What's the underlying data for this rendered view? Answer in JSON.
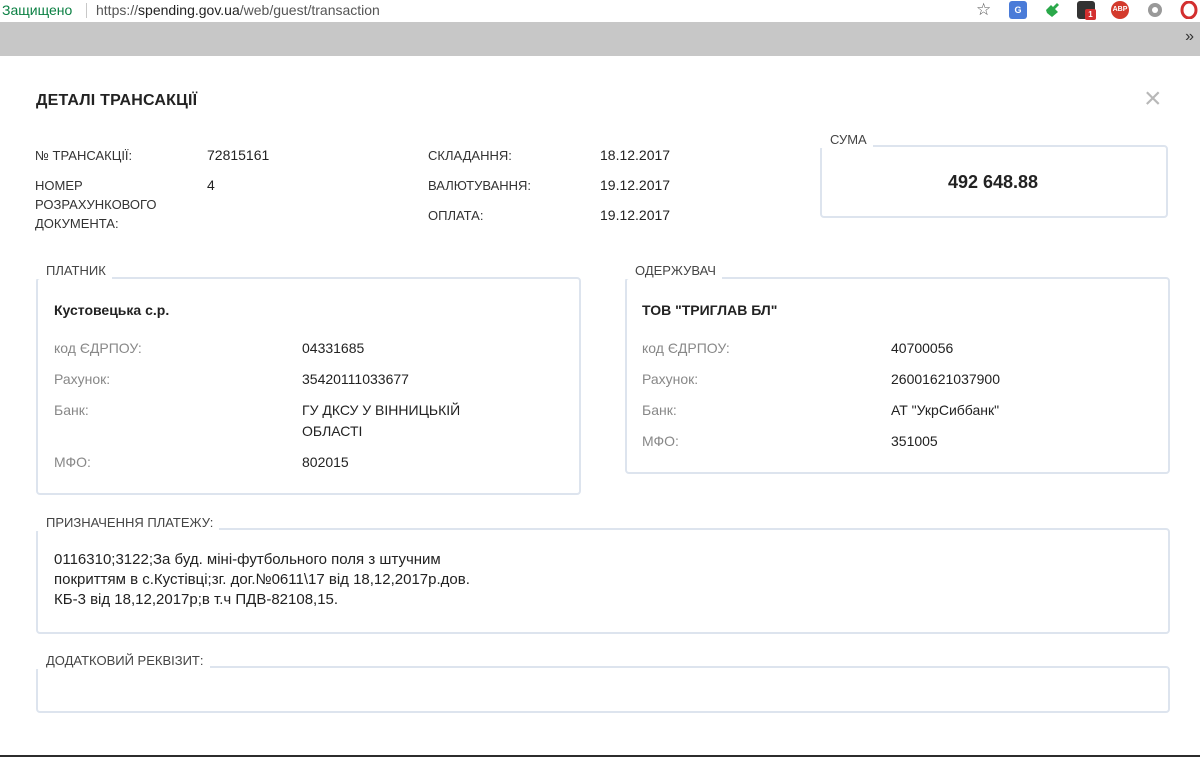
{
  "browser": {
    "secure_label": "Защищено",
    "url_scheme": "https://",
    "url_host": "spending.gov.ua",
    "url_path": "/web/guest/transaction",
    "chevron": "»",
    "extensions": [
      {
        "name": "translate-icon",
        "color": "#4a7bd8",
        "text": "G"
      },
      {
        "name": "puzzle-icon",
        "color": "#2aa84a",
        "text": ""
      },
      {
        "name": "ghost-extension-icon",
        "color": "#333333",
        "text": "1"
      },
      {
        "name": "adblock-icon",
        "color": "#d33a2c",
        "text": "ABP"
      },
      {
        "name": "circle-extension-icon",
        "color": "#888888",
        "text": ""
      },
      {
        "name": "opera-icon",
        "color": "#d32f2f",
        "text": "O"
      }
    ]
  },
  "dialog": {
    "title": "ДЕТАЛІ ТРАНСАКЦІЇ",
    "close": "×",
    "transaction_no_label": "№ ТРАНСАКЦІЇ:",
    "transaction_no": "72815161",
    "doc_no_label_1": "НОМЕР",
    "doc_no_label_2": "РОЗРАХУНКОВОГО",
    "doc_no_label_3": "ДОКУМЕНТА:",
    "doc_no": "4",
    "compiled_label": "СКЛАДАННЯ:",
    "compiled_date": "18.12.2017",
    "value_date_label": "ВАЛЮТУВАННЯ:",
    "value_date": "19.12.2017",
    "payment_label": "ОПЛАТА:",
    "payment_date": "19.12.2017",
    "sum_label": "СУМА",
    "sum_value": "492 648.88"
  },
  "payer": {
    "legend": "ПЛАТНИК",
    "name": "Кустовецька с.р.",
    "edrpou_label": "код ЄДРПОУ:",
    "edrpou": "04331685",
    "account_label": "Рахунок:",
    "account": "35420111033677",
    "bank_label": "Банк:",
    "bank_line1": "ГУ ДКСУ У ВІННИЦЬКІЙ",
    "bank_line2": "ОБЛАСТІ",
    "mfo_label": "МФО:",
    "mfo": "802015"
  },
  "recipient": {
    "legend": "ОДЕРЖУВАЧ",
    "name": "ТОВ \"ТРИГЛАВ БЛ\"",
    "edrpou_label": "код ЄДРПОУ:",
    "edrpou": "40700056",
    "account_label": "Рахунок:",
    "account": "26001621037900",
    "bank_label": "Банк:",
    "bank": "АТ \"УкрСиббанк\"",
    "mfo_label": "МФО:",
    "mfo": "351005"
  },
  "purpose": {
    "legend": "ПРИЗНАЧЕННЯ ПЛАТЕЖУ:",
    "line1": "0116310;3122;За буд. міні-футбольного поля з штучним",
    "line2": "покриттям в с.Кустівці;зг. дог.№0611\\17 від 18,12,2017р.дов.",
    "line3": "КБ-3 від 18,12,2017р;в т.ч ПДВ-82108,15."
  },
  "extra": {
    "legend": "ДОДАТКОВИЙ РЕКВІЗИТ:",
    "value": ""
  }
}
